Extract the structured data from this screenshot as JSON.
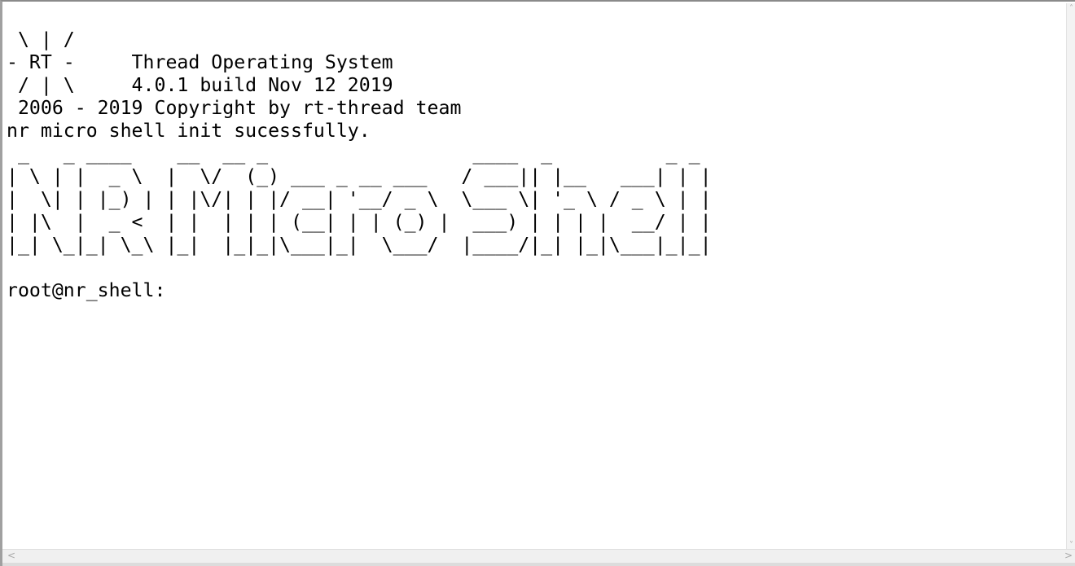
{
  "terminal": {
    "lines": [
      " \\ | /",
      "- RT -     Thread Operating System",
      " / | \\     4.0.1 build Nov 12 2019",
      " 2006 - 2019 Copyright by rt-thread team",
      "nr micro shell init sucessfully.",
      " _   _ ____    __  __ _                  ____  _          _ _ ",
      "| \\ | |  _ \\  |  \\/  (_) ___ _ __ ___   / ___|| |__   ___| | |",
      "|  \\| | |_) | | |\\/| | |/ __| '__/ _ \\  \\___ \\| '_ \\ / _ \\ | |",
      "| |\\  |  _ <  | |  | | | (__| | | (_) |  ___) | | | |  __/ | |",
      "|_| \\_|_| \\_\\ |_|  |_|_|\\___|_|  \\___/  |____/|_| |_|\\___|_|_|",
      "",
      "root@nr_shell: "
    ]
  },
  "scrollbar": {
    "up_arrow": "˄",
    "down_arrow": "˅",
    "left_arrow": "<",
    "right_arrow": ">"
  }
}
